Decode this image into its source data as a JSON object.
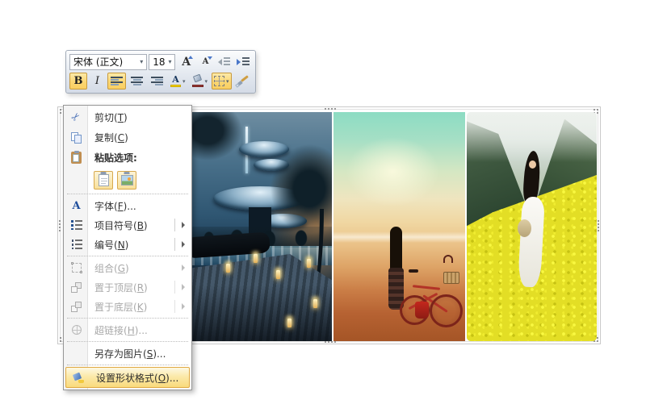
{
  "mini_toolbar": {
    "font_name": "宋体 (正文)",
    "font_size": "18",
    "bold_label": "B",
    "italic_label": "I",
    "grow_font_label": "A",
    "shrink_font_label": "A",
    "font_color_letter": "A",
    "dropdown_glyph": "▾",
    "active_buttons": [
      "bold",
      "align-left",
      "borders"
    ],
    "font_color_bar": "#ffd800",
    "fill_color_bar": "#9c3e3b",
    "active_button_color": "#f9d173"
  },
  "context_menu": {
    "items": [
      {
        "label": "剪切(T)",
        "state": "enabled",
        "icon": "scissors-icon"
      },
      {
        "label": "复制(C)",
        "state": "enabled",
        "icon": "copy-icon"
      },
      {
        "label": "粘贴选项:",
        "state": "enabled",
        "icon": "clipboard-icon"
      },
      {
        "label": "字体(F)...",
        "state": "enabled",
        "icon": "font-a-icon"
      },
      {
        "label": "项目符号(B)",
        "state": "enabled",
        "icon": "bullets-icon",
        "submenu": true
      },
      {
        "label": "编号(N)",
        "state": "enabled",
        "icon": "numbering-icon",
        "submenu": true
      },
      {
        "label": "组合(G)",
        "state": "disabled",
        "icon": "group-icon",
        "submenu": true
      },
      {
        "label": "置于顶层(R)",
        "state": "disabled",
        "icon": "bring-to-front-icon",
        "submenu": true
      },
      {
        "label": "置于底层(K)",
        "state": "disabled",
        "icon": "send-to-back-icon",
        "submenu": true
      },
      {
        "label": "超链接(H)...",
        "state": "disabled",
        "icon": "hyperlink-icon"
      },
      {
        "label": "另存为图片(S)...",
        "state": "enabled",
        "icon": "none"
      },
      {
        "label": "设置形状格式(O)...",
        "state": "highlighted",
        "icon": "format-shape-icon"
      }
    ],
    "paste_option_icons": [
      "paste-keep-source-icon",
      "paste-as-picture-icon"
    ],
    "hover_highlight_color": "#f9da7c",
    "hover_border_color": "#e0a943"
  },
  "slide": {
    "selected_object": "three-photo table/group with selection frame and grip handles",
    "photos": [
      {
        "name": "futuristic-ocean-resort-at-dusk",
        "palette": [
          "#49708a",
          "#10222f",
          "#d69452",
          "#e2f0f8"
        ]
      },
      {
        "name": "beach-with-red-bicycle",
        "palette": [
          "#8cdcc3",
          "#efe5bf",
          "#ca7d46",
          "#b23327"
        ]
      },
      {
        "name": "woman-in-yellow-flower-field",
        "palette": [
          "#eaeeea",
          "#2c4530",
          "#e3de25",
          "#fbfaf6"
        ]
      }
    ]
  },
  "icons": {
    "scissors_glyph": "✂",
    "toolbar": [
      "grow-font-icon",
      "shrink-font-icon",
      "promote-list-icon",
      "demote-list-icon",
      "align-left-icon",
      "align-center-icon",
      "align-right-icon",
      "font-color-icon",
      "shape-fill-icon",
      "borders-icon",
      "format-painter-icon"
    ]
  }
}
